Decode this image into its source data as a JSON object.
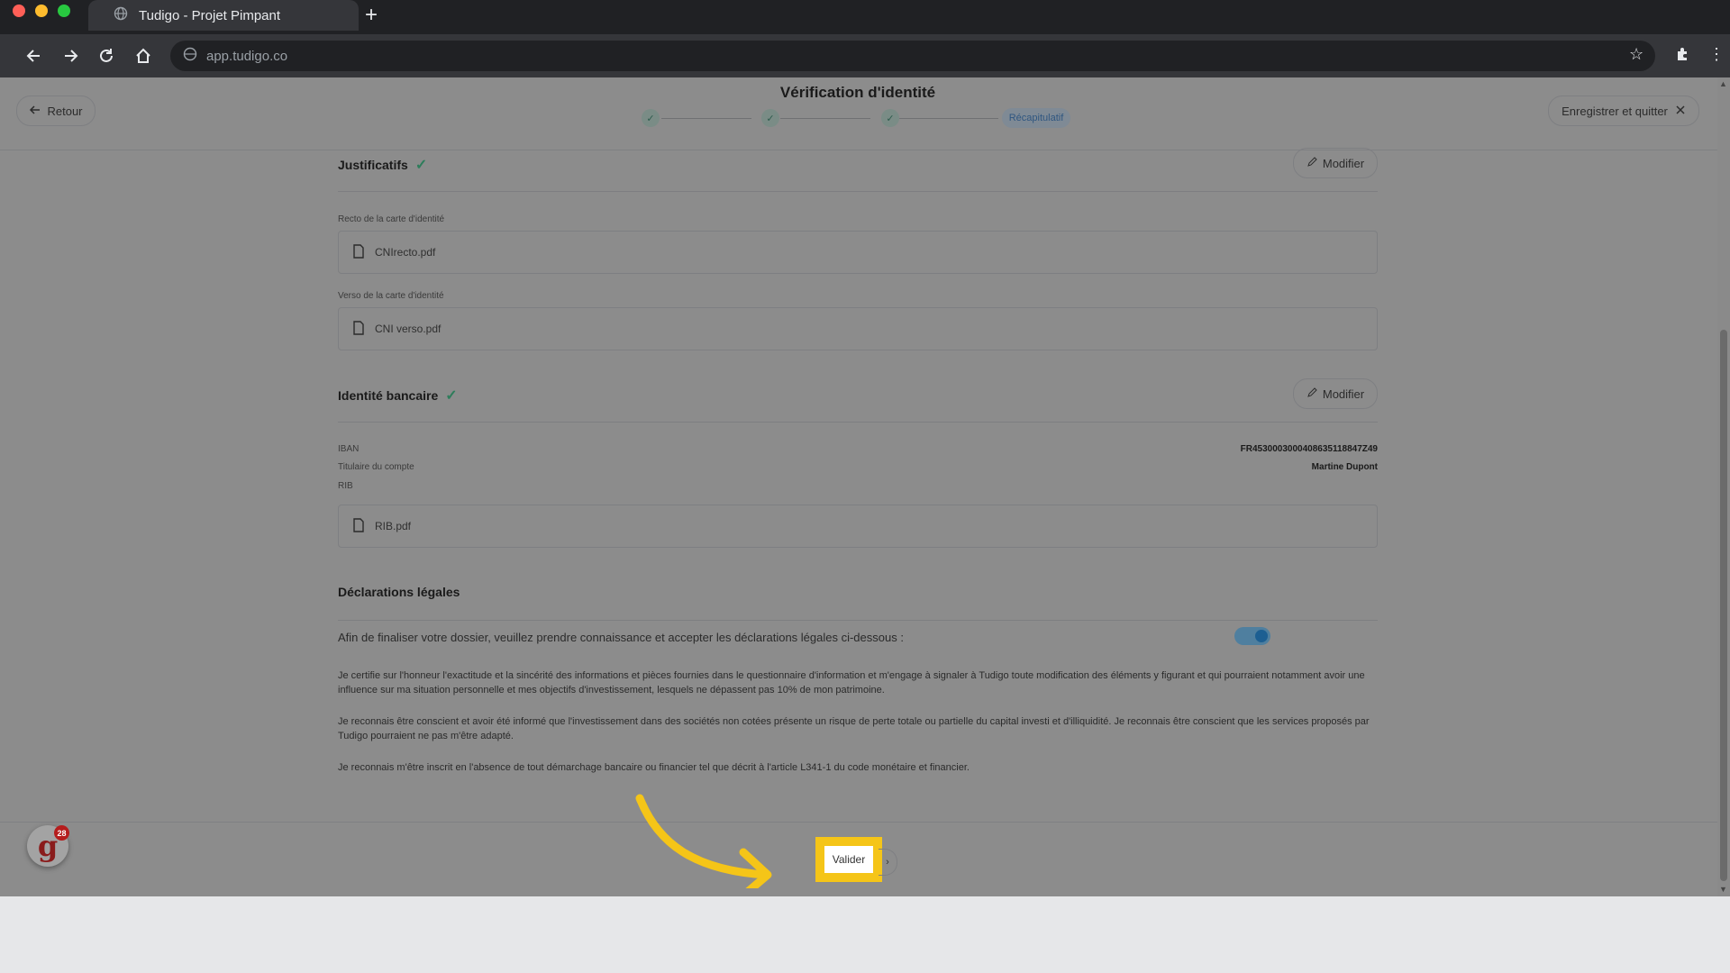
{
  "browser": {
    "tab_title": "Tudigo - Projet Pimpant",
    "new_tab": "+",
    "url": "app.tudigo.co"
  },
  "header": {
    "back_label": "Retour",
    "title": "Vérification d'identité",
    "current_step": "Récapitulatif",
    "save_quit_label": "Enregistrer et quitter"
  },
  "justificatifs": {
    "title": "Justificatifs",
    "modify_label": "Modifier",
    "recto_label": "Recto de la carte d'identité",
    "recto_file": "CNIrecto.pdf",
    "verso_label": "Verso de la carte d'identité",
    "verso_file": "CNI verso.pdf"
  },
  "banque": {
    "title": "Identité bancaire",
    "modify_label": "Modifier",
    "iban_label": "IBAN",
    "iban_value": "FR4530003000408635118847Z49",
    "holder_label": "Titulaire du compte",
    "holder_value": "Martine Dupont",
    "rib_label": "RIB",
    "rib_file": "RIB.pdf"
  },
  "declarations": {
    "title": "Déclarations légales",
    "intro": "Afin de finaliser votre dossier, veuillez prendre connaissance et accepter les déclarations légales ci-dessous :",
    "p1": "Je certifie sur l'honneur l'exactitude et la sincérité des informations et pièces fournies dans le questionnaire d'information et m'engage à signaler à Tudigo toute modification des éléments y figurant et qui pourraient notamment avoir une influence sur ma situation personnelle et mes objectifs d'investissement, lesquels ne dépassent pas 10% de mon patrimoine.",
    "p2": "Je reconnais être conscient et avoir été informé que l'investissement dans des sociétés non cotées présente un risque de perte totale ou partielle du capital investi et d'illiquidité. Je reconnais être conscient que les services proposés par Tudigo pourraient ne pas m'être adapté.",
    "p3": "Je reconnais m'être inscrit en l'absence de tout démarchage bancaire ou financier tel que décrit à l'article L341-1 du code monétaire et financier."
  },
  "footer": {
    "validate_label": "Valider",
    "logo_letter": "g",
    "badge_count": "28"
  },
  "colors": {
    "highlight": "#f5c518",
    "check": "#2e7d5b",
    "toggle": "#1d5f92"
  }
}
